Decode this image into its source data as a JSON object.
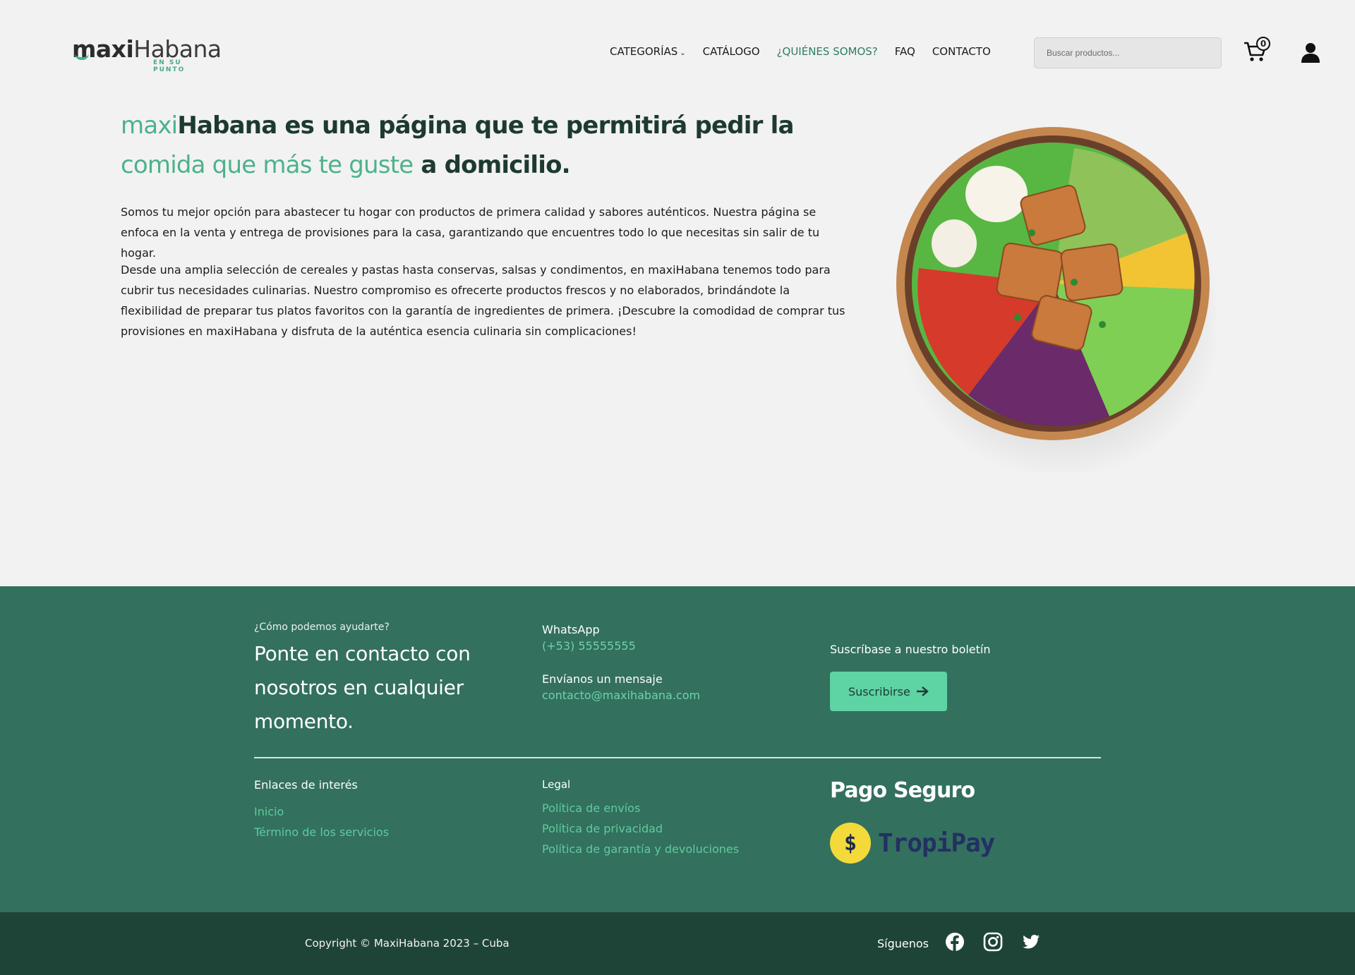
{
  "header": {
    "logo_prefix": "maxi",
    "logo_suffix": "Habana",
    "logo_tag": "EN SU PUNTO",
    "nav": [
      {
        "label": "CATEGORÍAS",
        "has_dropdown": true,
        "active": false
      },
      {
        "label": "CATÁLOGO",
        "active": false
      },
      {
        "label": "¿QUIÉNES SOMOS?",
        "active": true
      },
      {
        "label": "FAQ",
        "active": false
      },
      {
        "label": "CONTACTO",
        "active": false
      }
    ],
    "search_placeholder": "Buscar productos...",
    "cart_count": "0",
    "icons": {
      "cart": "cart-icon",
      "user": "user-icon",
      "chevron": "chevron-down-icon"
    }
  },
  "hero": {
    "title_parts": {
      "p1": "maxi",
      "p2": "Habana es una página que te permitirá pedir la ",
      "p3": "comida que más te guste",
      "p4": " a domicilio."
    },
    "paragraph1": "Somos tu mejor opción para abastecer tu hogar con productos de primera calidad y sabores auténticos. Nuestra página se enfoca en la venta y entrega de provisiones para la casa, garantizando que encuentres todo lo que necesitas sin salir de tu hogar.",
    "paragraph2": "Desde una amplia selección de cereales y pastas hasta conservas, salsas y condimentos, en maxiHabana tenemos todo para cubrir tus necesidades culinarias. Nuestro compromiso es ofrecerte productos frescos y no elaborados, brindándote la flexibilidad de preparar tus platos favoritos con la garantía de ingredientes de primera. ¡Descubre la comodidad de comprar tus provisiones en maxiHabana y disfruta de la auténtica esencia culinaria sin complicaciones!"
  },
  "footer": {
    "help_small": "¿Cómo podemos ayudarte?",
    "help_big": "Ponte en contacto con nosotros en cualquier momento.",
    "whatsapp_label": "WhatsApp",
    "whatsapp_value": "(+53) 55555555",
    "message_label": "Envíanos un mensaje",
    "message_value": "contacto@maxihabana.com",
    "newsletter_label": "Suscríbase a nuestro boletín",
    "subscribe_button": "Suscribirse",
    "links_heading": "Enlaces de interés",
    "links": [
      "Inicio",
      "Término de los servicios"
    ],
    "legal_heading": "Legal",
    "legal_links": [
      "Política de envíos",
      "Política de privacidad",
      "Política de garantía y devoluciones"
    ],
    "pago_heading": "Pago Seguro",
    "tropipay_symbol": "$",
    "tropipay_word": "TropiPay"
  },
  "bottom": {
    "copyright": "Copyright © MaxiHabana 2023 – Cuba",
    "follow_label": "Síguenos",
    "social_icons": [
      "facebook-icon",
      "instagram-icon",
      "twitter-icon"
    ]
  },
  "colors": {
    "accent_green": "#4cb28c",
    "dark_green": "#1d3a32",
    "footer_bg": "#33705e",
    "bottom_bg": "#1e4438",
    "button_bg": "#5ed3a4"
  }
}
